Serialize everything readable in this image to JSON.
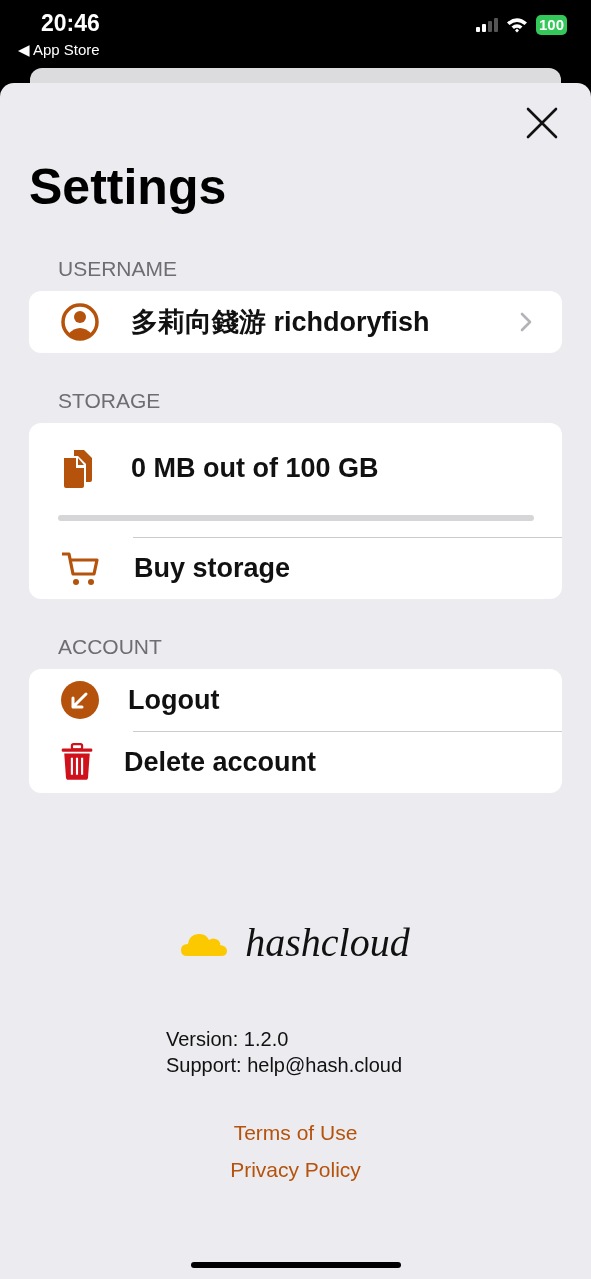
{
  "status_bar": {
    "time": "20:46",
    "back_link": "◀ App Store",
    "battery": "100"
  },
  "title": "Settings",
  "sections": [
    {
      "header": "USERNAME",
      "rows": [
        {
          "kind": "user",
          "label": "多莉向錢游 richdoryfish",
          "chevron": true
        }
      ]
    },
    {
      "header": "STORAGE",
      "rows": [
        {
          "kind": "usage",
          "label": "0 MB out of 100 GB",
          "level": 0
        },
        {
          "kind": "buy",
          "label": "Buy storage"
        }
      ]
    },
    {
      "header": "ACCOUNT",
      "rows": [
        {
          "kind": "logout",
          "label": "Logout"
        },
        {
          "kind": "delete",
          "label": "Delete account"
        }
      ]
    }
  ],
  "logo": "hashcloud",
  "info": [
    "Version: 1.2.0",
    "Support: help@hash.cloud"
  ],
  "links": [
    "Terms of Use",
    "Privacy Policy"
  ]
}
